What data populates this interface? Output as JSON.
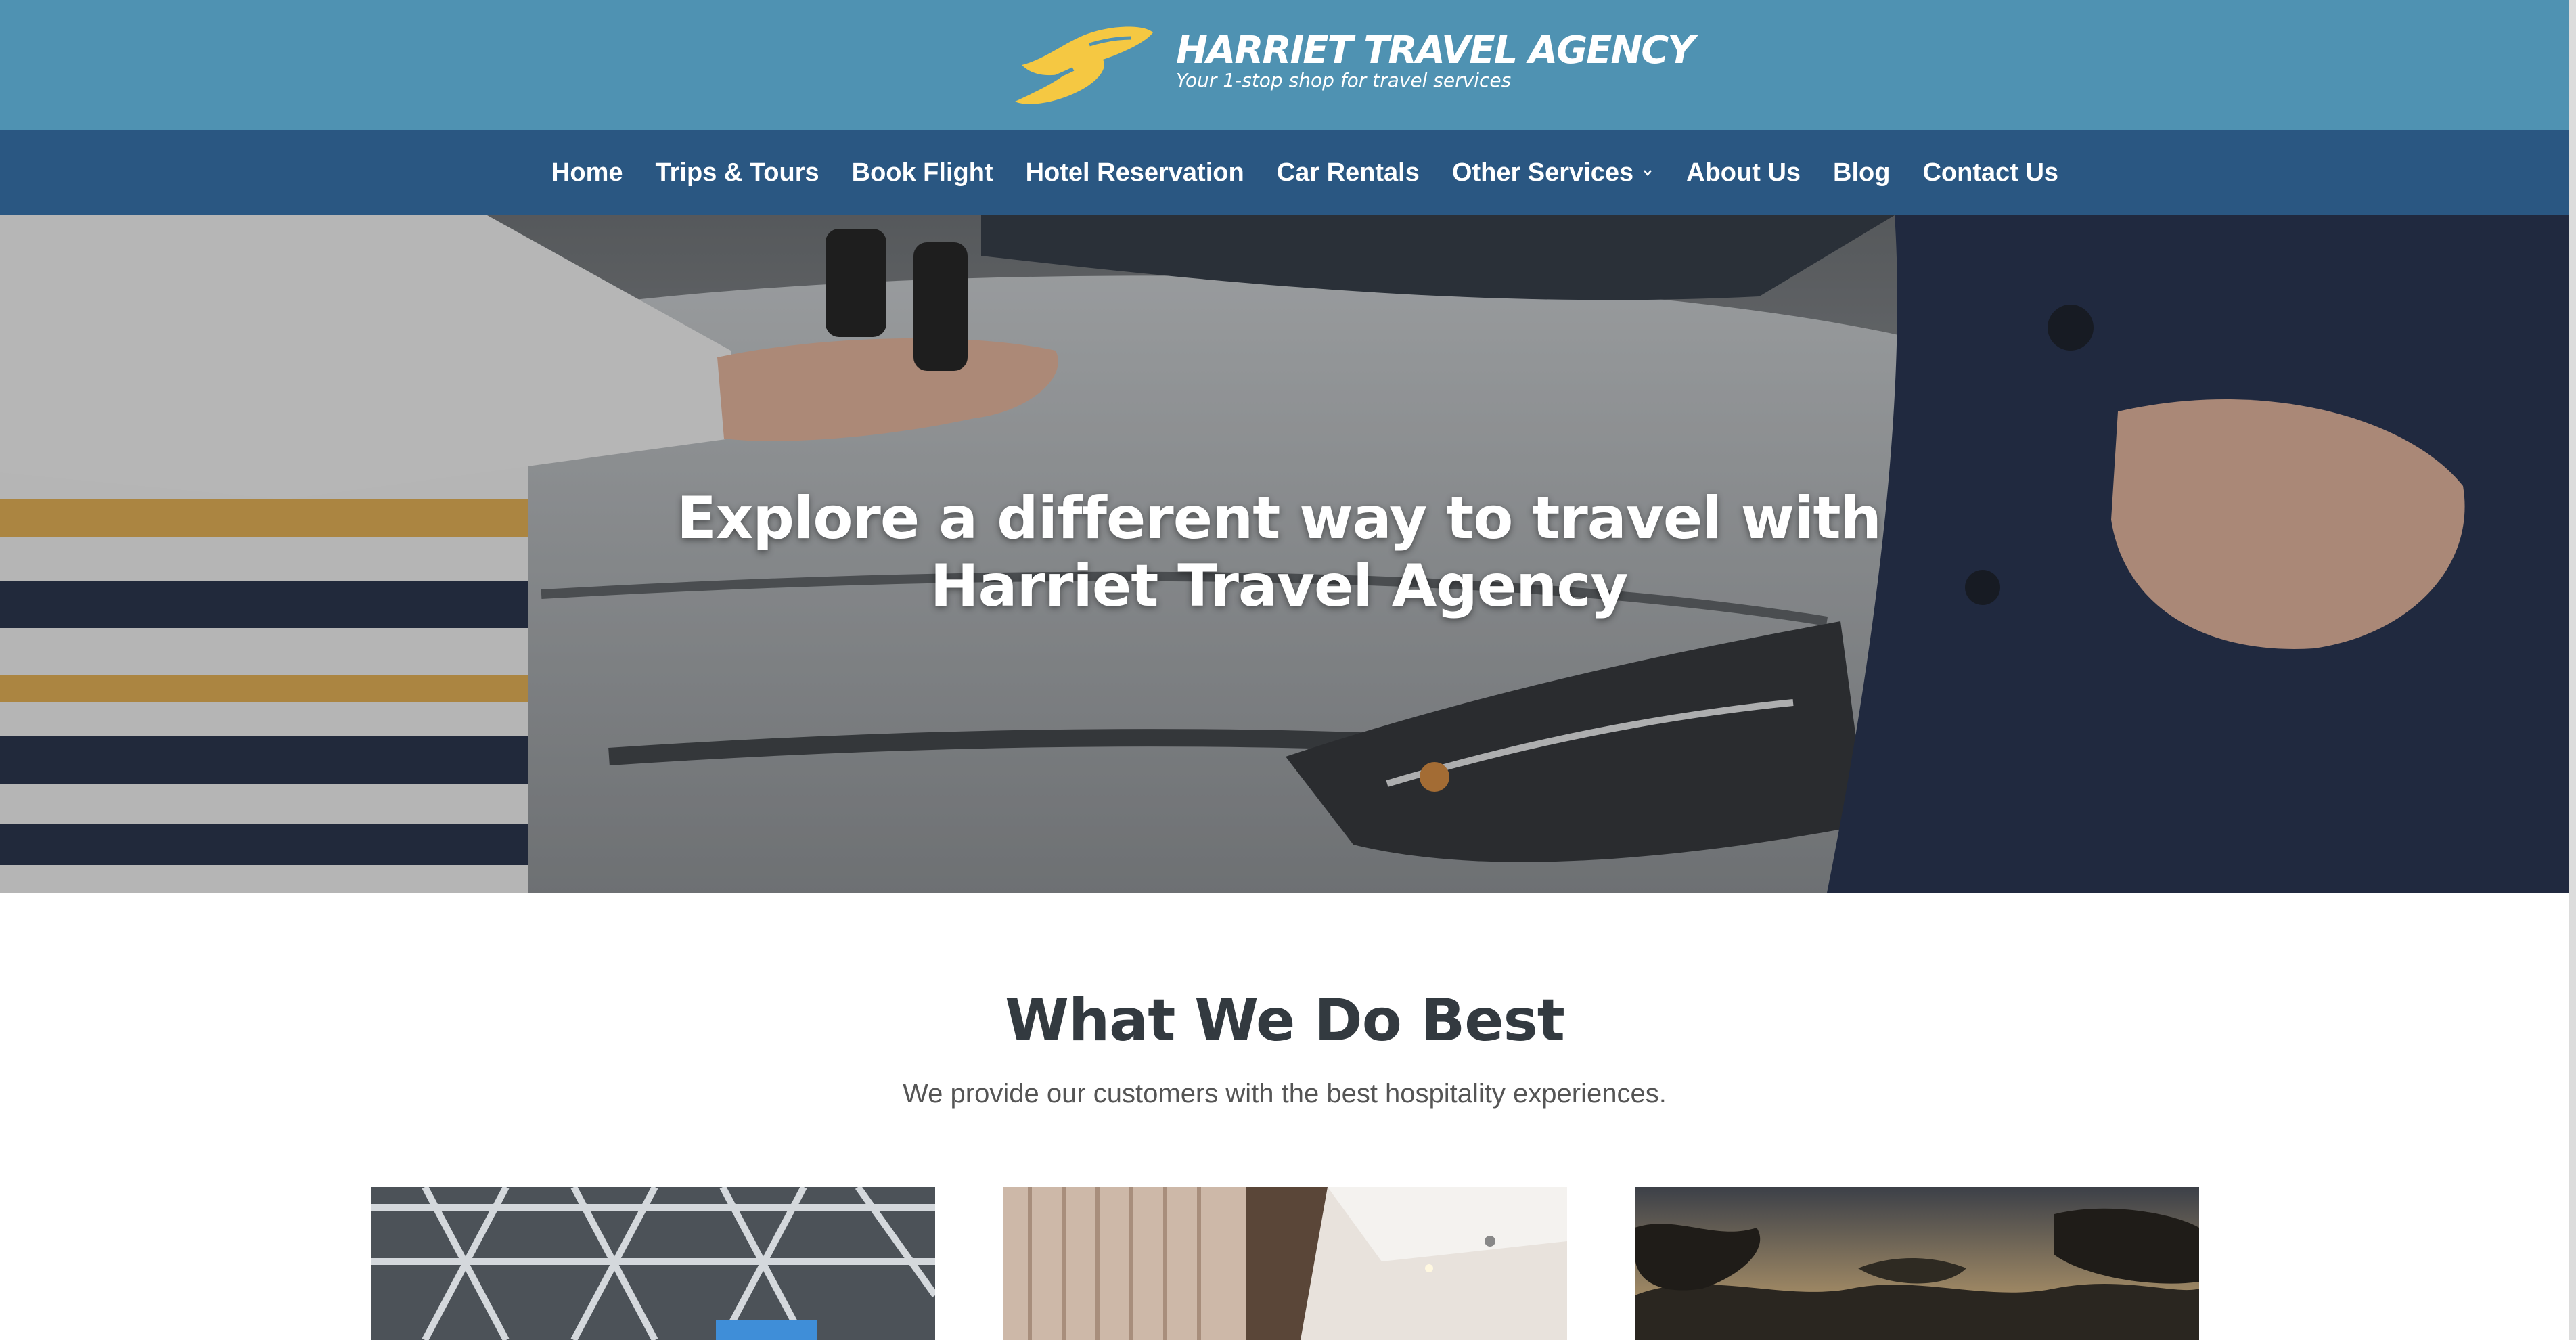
{
  "brand": {
    "name": "HARRIET TRAVEL AGENCY",
    "tagline": "Your 1-stop shop for travel services",
    "logo_icon": "plane-wing-logo-icon",
    "accent_color": "#f5c842"
  },
  "nav": {
    "items": [
      {
        "label": "Home"
      },
      {
        "label": "Trips & Tours"
      },
      {
        "label": "Book Flight"
      },
      {
        "label": "Hotel Reservation"
      },
      {
        "label": "Car Rentals"
      },
      {
        "label": "Other Services",
        "has_dropdown": true
      },
      {
        "label": "About Us"
      },
      {
        "label": "Blog"
      },
      {
        "label": "Contact Us"
      }
    ],
    "colors": {
      "top_bar": "#4f92b2",
      "nav_bar": "#2a5782"
    }
  },
  "hero": {
    "title": "Explore a different way to travel with Harriet Travel Agency",
    "image": "car-key-handover-photo"
  },
  "section": {
    "title": "What We Do Best",
    "subtitle": "We provide our customers with the best hospitality experiences.",
    "cards": [
      {
        "image": "airport-terminal-photo"
      },
      {
        "image": "hotel-room-photo"
      },
      {
        "image": "savanna-trees-photo"
      }
    ]
  }
}
